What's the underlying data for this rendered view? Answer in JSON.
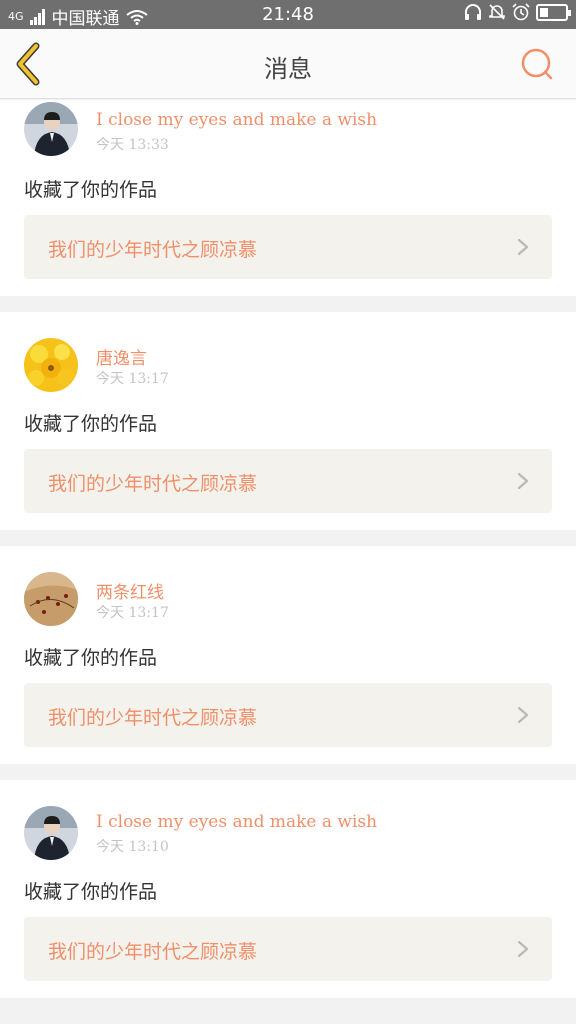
{
  "status_bar": {
    "carrier": "中国联通",
    "network": "4G",
    "time": "21:48"
  },
  "header": {
    "title": "消息",
    "back_icon": "chevron-left-icon",
    "search_icon": "search-icon"
  },
  "colors": {
    "accent": "#f0906a",
    "back_arrow": "#f2c230",
    "card_link_bg": "#f3f2ec",
    "status_bar_bg": "#6f6f6f"
  },
  "notifications": [
    {
      "username": "I close my eyes and make a wish",
      "time": "今天 13:33",
      "action": "收藏了你的作品",
      "work_title": "我们的少年时代之顾凉慕"
    },
    {
      "username": "唐逸言",
      "time": "今天 13:17",
      "action": "收藏了你的作品",
      "work_title": "我们的少年时代之顾凉慕"
    },
    {
      "username": "两条红线",
      "time": "今天 13:17",
      "action": "收藏了你的作品",
      "work_title": "我们的少年时代之顾凉慕"
    },
    {
      "username": "I close my eyes and make a wish",
      "time": "今天 13:10",
      "action": "收藏了你的作品",
      "work_title": "我们的少年时代之顾凉慕"
    }
  ]
}
